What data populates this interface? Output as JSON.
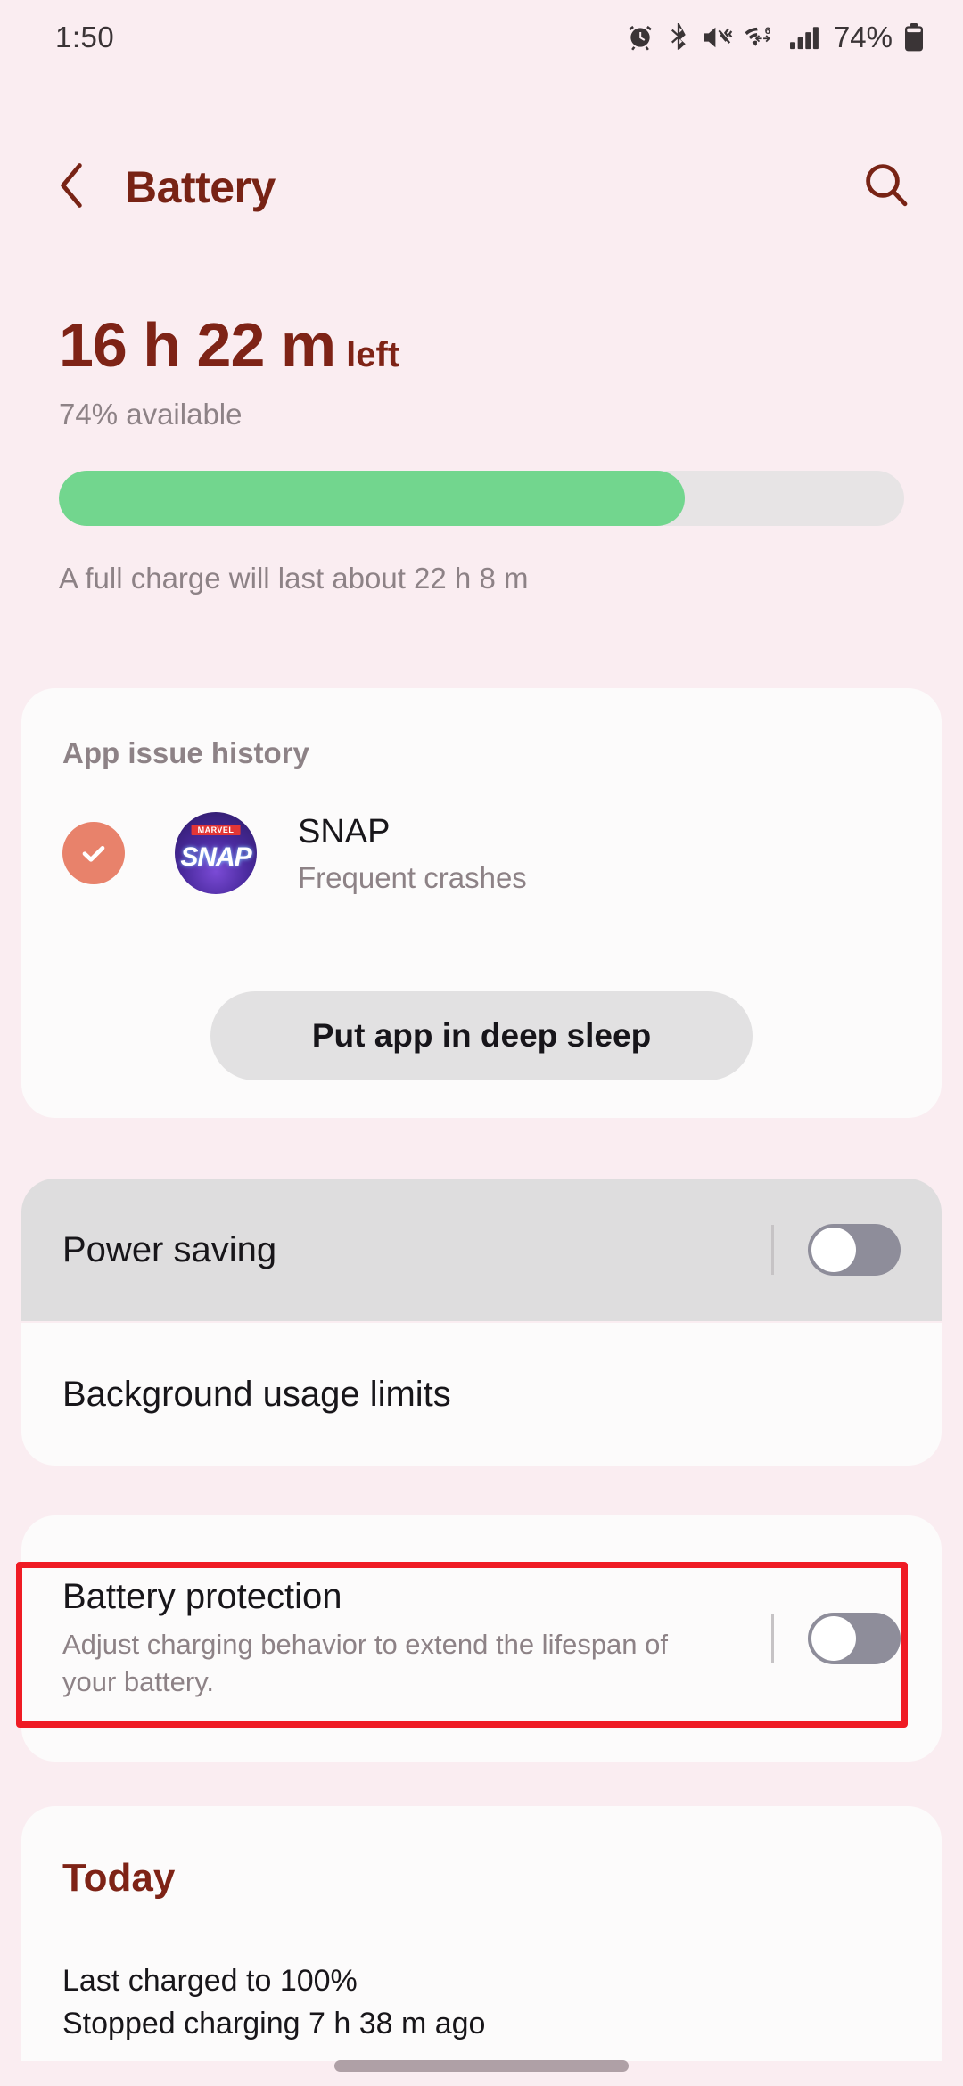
{
  "status_bar": {
    "time": "1:50",
    "battery_percent": "74%",
    "icons": [
      "alarm-icon",
      "bluetooth-icon",
      "mute-vibrate-icon",
      "wifi6-icon",
      "signal-icon",
      "battery-icon"
    ]
  },
  "app_bar": {
    "back_icon": "chevron-left-icon",
    "title": "Battery",
    "search_icon": "search-icon"
  },
  "hero": {
    "time_remaining": "16 h 22 m",
    "left_suffix": "left",
    "available": "74% available",
    "full_charge_note": "A full charge will last about 22 h 8 m",
    "battery_level_percent": 74,
    "fill_color": "#72D68E",
    "track_color": "#E7E4E5"
  },
  "app_issue_history": {
    "heading": "App issue history",
    "status_icon": "check-circle-icon",
    "status_color": "#E8826B",
    "app_icon": "marvel-snap-app-icon",
    "app_icon_brand": "MARVEL",
    "app_icon_word": "SNAP",
    "app_name": "SNAP",
    "issue": "Frequent crashes",
    "action_button": "Put app in deep sleep"
  },
  "settings": {
    "power_saving": {
      "label": "Power saving",
      "toggle_state": "off"
    },
    "background_usage_limits": {
      "label": "Background usage limits"
    },
    "battery_protection": {
      "label": "Battery protection",
      "description": "Adjust charging behavior to extend the lifespan of your battery.",
      "toggle_state": "off",
      "highlight_color": "#EF1B24"
    }
  },
  "today": {
    "title": "Today",
    "line1": "Last charged to 100%",
    "line2": "Stopped charging 7 h 38 m ago"
  },
  "colors": {
    "background": "#FAEDF1",
    "card": "#FCFBFB",
    "accent": "#7E2316",
    "muted_text": "#8D8286"
  }
}
